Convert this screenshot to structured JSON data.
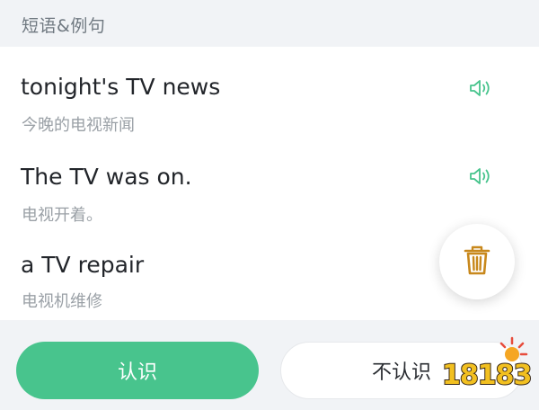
{
  "section": {
    "title": "短语&例句"
  },
  "phrases": [
    {
      "en": "tonight's TV news",
      "zh": "今晚的电视新闻",
      "icon": "speaker-icon"
    },
    {
      "en": "The TV was on.",
      "zh": "电视开着。",
      "icon": "speaker-icon"
    },
    {
      "en": "a TV repair",
      "zh": "电视机维修"
    }
  ],
  "fab": {
    "icon": "trash-icon"
  },
  "actions": {
    "know_label": "认识",
    "unknown_label": "不认识"
  },
  "watermark": {
    "text": "18183"
  },
  "colors": {
    "accent": "#48c48d",
    "trash": "#c8881c",
    "background": "#f1f3f6"
  }
}
